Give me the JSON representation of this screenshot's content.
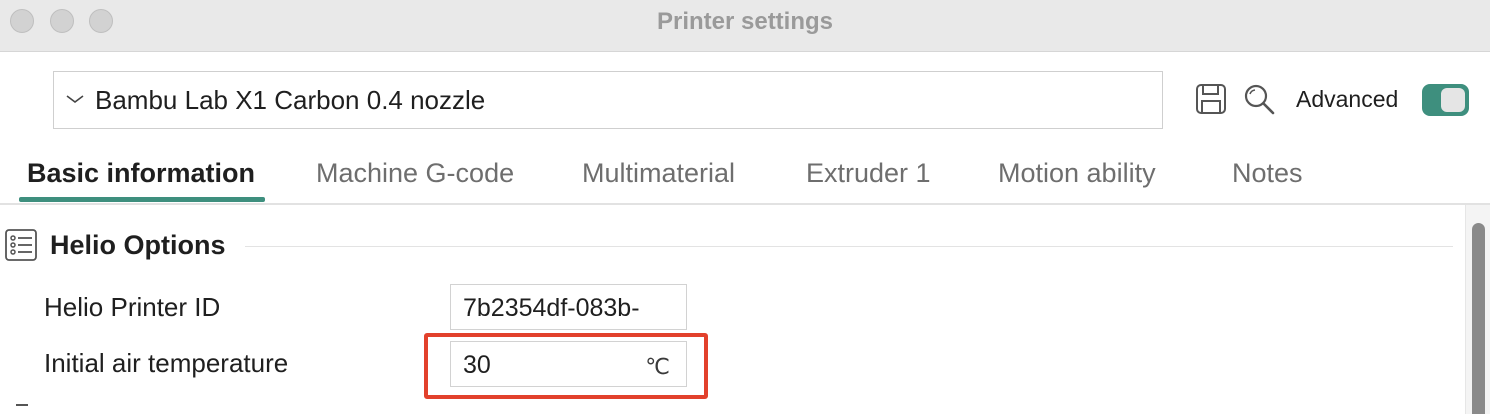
{
  "window": {
    "title": "Printer settings"
  },
  "preset": {
    "selected": "Bambu Lab X1 Carbon 0.4 nozzle"
  },
  "toolbar": {
    "advanced_label": "Advanced",
    "advanced_enabled": true
  },
  "tabs": [
    {
      "label": "Basic information",
      "active": true
    },
    {
      "label": "Machine G-code",
      "active": false
    },
    {
      "label": "Multimaterial",
      "active": false
    },
    {
      "label": "Extruder 1",
      "active": false
    },
    {
      "label": "Motion ability",
      "active": false
    },
    {
      "label": "Notes",
      "active": false
    }
  ],
  "section": {
    "title": "Helio Options"
  },
  "fields": [
    {
      "label": "Helio Printer ID",
      "value": "7b2354df-083b-",
      "unit": ""
    },
    {
      "label": "Initial air temperature",
      "value": "30",
      "unit": "℃"
    }
  ],
  "colors": {
    "accent": "#3e8f7e",
    "highlight": "#e2412c"
  },
  "icons": {
    "preset_dropdown": "chevron-down-icon",
    "save": "save-icon",
    "search": "search-icon",
    "section": "list-settings-icon"
  }
}
